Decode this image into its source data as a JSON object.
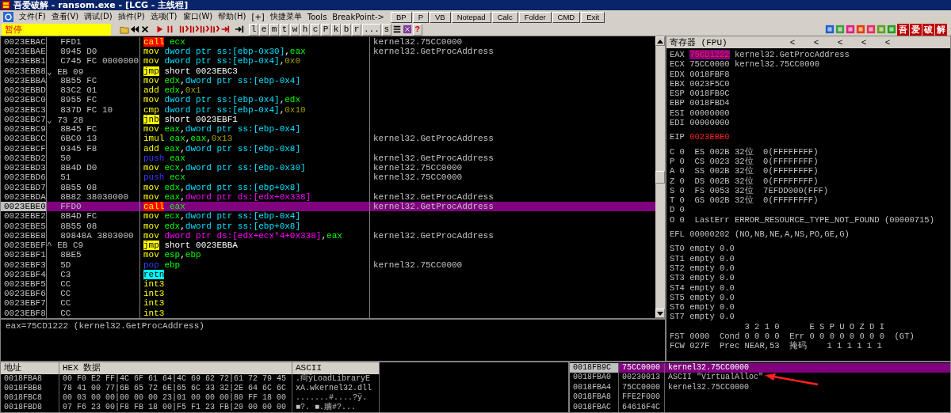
{
  "window": {
    "title": "吾爱破解 - ransom.exe - [LCG -  主线程]"
  },
  "menu": [
    "文件(F)",
    "查看(V)",
    "调试(D)",
    "插件(P)",
    "选项(T)",
    "窗口(W)",
    "帮助(H)",
    "[+]",
    "快捷菜单",
    "Tools",
    "BreakPoint->"
  ],
  "toolbar": {
    "status": "暂停",
    "letters": [
      "l",
      "e",
      "m",
      "t",
      "w",
      "h",
      "c",
      "P",
      "k",
      "b",
      "r",
      "...",
      "s"
    ],
    "help": "?",
    "tiles": [
      "吾",
      "爱",
      "破",
      "解"
    ]
  },
  "tool_buttons": [
    "BP",
    "P",
    "VB",
    "Notepad",
    "Calc",
    "Folder",
    "CMD",
    "Exit"
  ],
  "disassembly": [
    {
      "address": "0023EBAC",
      "hex": "FFD1",
      "mnemonic": "call",
      "kind": "call",
      "operands": [
        {
          "kind": "reg",
          "t": "ecx"
        }
      ],
      "comment": "kernel32.75CC0000",
      "selected": false
    },
    {
      "address": "0023EBAE",
      "hex": "8945 D0",
      "mnemonic": "mov",
      "kind": "op",
      "operands": [
        {
          "kind": "ss",
          "t": "dword ptr ss:[ebp-0x30]"
        },
        {
          "kind": "txt",
          "t": ","
        },
        {
          "kind": "reg",
          "t": "eax"
        }
      ],
      "comment": "kernel32.GetProcAddress",
      "selected": false
    },
    {
      "address": "0023EBB1",
      "hex": "C745 FC 0000000",
      "mnemonic": "mov",
      "kind": "op",
      "operands": [
        {
          "kind": "ss",
          "t": "dword ptr ss:[ebp-0x4]"
        },
        {
          "kind": "txt",
          "t": ","
        },
        {
          "kind": "imm",
          "t": "0x0"
        }
      ],
      "selected": false
    },
    {
      "address": "0023EBB8",
      "mark": "⌄",
      "hex": "EB 09",
      "mnemonic": "jmp",
      "kind": "jump",
      "operands": [
        {
          "kind": "txt",
          "t": "short 0023EBC3"
        }
      ],
      "selected": false
    },
    {
      "address": "0023EBBA",
      "hex": "8B55 FC",
      "mnemonic": "mov",
      "kind": "op",
      "operands": [
        {
          "kind": "reg",
          "t": "edx"
        },
        {
          "kind": "txt",
          "t": ","
        },
        {
          "kind": "ss",
          "t": "dword ptr ss:[ebp-0x4]"
        }
      ],
      "selected": false
    },
    {
      "address": "0023EBBD",
      "hex": "83C2 01",
      "mnemonic": "add",
      "kind": "op",
      "operands": [
        {
          "kind": "reg",
          "t": "edx"
        },
        {
          "kind": "txt",
          "t": ","
        },
        {
          "kind": "imm",
          "t": "0x1"
        }
      ],
      "selected": false
    },
    {
      "address": "0023EBC0",
      "hex": "8955 FC",
      "mnemonic": "mov",
      "kind": "op",
      "operands": [
        {
          "kind": "ss",
          "t": "dword ptr ss:[ebp-0x4]"
        },
        {
          "kind": "txt",
          "t": ","
        },
        {
          "kind": "reg",
          "t": "edx"
        }
      ],
      "selected": false
    },
    {
      "address": "0023EBC3",
      "hex": "837D FC 10",
      "mnemonic": "cmp",
      "kind": "op",
      "operands": [
        {
          "kind": "ss",
          "t": "dword ptr ss:[ebp-0x4]"
        },
        {
          "kind": "txt",
          "t": ","
        },
        {
          "kind": "imm",
          "t": "0x10"
        }
      ],
      "selected": false
    },
    {
      "address": "0023EBC7",
      "mark": "⌄",
      "hex": "73 28",
      "mnemonic": "jnb",
      "kind": "jump",
      "operands": [
        {
          "kind": "txt",
          "t": "short 0023EBF1"
        }
      ],
      "selected": false
    },
    {
      "address": "0023EBC9",
      "hex": "8B45 FC",
      "mnemonic": "mov",
      "kind": "op",
      "operands": [
        {
          "kind": "reg",
          "t": "eax"
        },
        {
          "kind": "txt",
          "t": ","
        },
        {
          "kind": "ss",
          "t": "dword ptr ss:[ebp-0x4]"
        }
      ],
      "selected": false
    },
    {
      "address": "0023EBCC",
      "hex": "6BC0 13",
      "mnemonic": "imul",
      "kind": "op",
      "operands": [
        {
          "kind": "reg",
          "t": "eax"
        },
        {
          "kind": "txt",
          "t": ","
        },
        {
          "kind": "reg",
          "t": "eax"
        },
        {
          "kind": "txt",
          "t": ","
        },
        {
          "kind": "imm",
          "t": "0x13"
        }
      ],
      "comment": "kernel32.GetProcAddress",
      "selected": false
    },
    {
      "address": "0023EBCF",
      "hex": "0345 F8",
      "mnemonic": "add",
      "kind": "op",
      "operands": [
        {
          "kind": "reg",
          "t": "eax"
        },
        {
          "kind": "txt",
          "t": ","
        },
        {
          "kind": "ss",
          "t": "dword ptr ss:[ebp-0x8]"
        }
      ],
      "selected": false
    },
    {
      "address": "0023EBD2",
      "hex": "50",
      "mnemonic": "push",
      "kind": "stack",
      "operands": [
        {
          "kind": "reg",
          "t": "eax"
        }
      ],
      "comment": "kernel32.GetProcAddress",
      "selected": false
    },
    {
      "address": "0023EBD3",
      "hex": "8B4D D0",
      "mnemonic": "mov",
      "kind": "op",
      "operands": [
        {
          "kind": "reg",
          "t": "ecx"
        },
        {
          "kind": "txt",
          "t": ","
        },
        {
          "kind": "ss",
          "t": "dword ptr ss:[ebp-0x30]"
        }
      ],
      "comment": "kernel32.75CC0000",
      "selected": false
    },
    {
      "address": "0023EBD6",
      "hex": "51",
      "mnemonic": "push",
      "kind": "stack",
      "operands": [
        {
          "kind": "reg",
          "t": "ecx"
        }
      ],
      "comment": "kernel32.75CC0000",
      "selected": false
    },
    {
      "address": "0023EBD7",
      "hex": "8B55 08",
      "mnemonic": "mov",
      "kind": "op",
      "operands": [
        {
          "kind": "reg",
          "t": "edx"
        },
        {
          "kind": "txt",
          "t": ","
        },
        {
          "kind": "ss",
          "t": "dword ptr ss:[ebp+0x8]"
        }
      ],
      "selected": false
    },
    {
      "address": "0023EBDA",
      "hex": "8B82 38030000",
      "mnemonic": "mov",
      "kind": "op",
      "operands": [
        {
          "kind": "reg",
          "t": "eax"
        },
        {
          "kind": "txt",
          "t": ","
        },
        {
          "kind": "ds",
          "t": "dword ptr ds:[edx+0x338]"
        }
      ],
      "comment": "kernel32.GetProcAddress",
      "selected": false
    },
    {
      "address": "0023EBE0",
      "hex": "FFD0",
      "mnemonic": "call",
      "kind": "call",
      "operands": [
        {
          "kind": "reg",
          "t": "eax"
        }
      ],
      "comment": "kernel32.GetProcAddress",
      "selected": true
    },
    {
      "address": "0023EBE2",
      "hex": "8B4D FC",
      "mnemonic": "mov",
      "kind": "op",
      "operands": [
        {
          "kind": "reg",
          "t": "ecx"
        },
        {
          "kind": "txt",
          "t": ","
        },
        {
          "kind": "ss",
          "t": "dword ptr ss:[ebp-0x4]"
        }
      ],
      "selected": false
    },
    {
      "address": "0023EBE5",
      "hex": "8B55 08",
      "mnemonic": "mov",
      "kind": "op",
      "operands": [
        {
          "kind": "reg",
          "t": "edx"
        },
        {
          "kind": "txt",
          "t": ","
        },
        {
          "kind": "ss",
          "t": "dword ptr ss:[ebp+0x8]"
        }
      ],
      "selected": false
    },
    {
      "address": "0023EBE8",
      "hex": "89848A 3803000",
      "mnemonic": "mov",
      "kind": "op",
      "operands": [
        {
          "kind": "ds",
          "t": "dword ptr ds:[edx+ecx*4+0x338]"
        },
        {
          "kind": "txt",
          "t": ","
        },
        {
          "kind": "reg",
          "t": "eax"
        }
      ],
      "comment": "kernel32.GetProcAddress",
      "selected": false
    },
    {
      "address": "0023EBEF",
      "mark": "^",
      "hex": "EB C9",
      "mnemonic": "jmp",
      "kind": "jump",
      "operands": [
        {
          "kind": "txt",
          "t": "short 0023EBBA"
        }
      ],
      "selected": false
    },
    {
      "address": "0023EBF1",
      "hex": "8BE5",
      "mnemonic": "mov",
      "kind": "op",
      "operands": [
        {
          "kind": "reg",
          "t": "esp"
        },
        {
          "kind": "txt",
          "t": ","
        },
        {
          "kind": "reg",
          "t": "ebp"
        }
      ],
      "selected": false
    },
    {
      "address": "0023EBF3",
      "hex": "5D",
      "mnemonic": "pop",
      "kind": "stack",
      "operands": [
        {
          "kind": "reg",
          "t": "ebp"
        }
      ],
      "comment": "kernel32.75CC0000",
      "selected": false
    },
    {
      "address": "0023EBF4",
      "hex": "C3",
      "mnemonic": "retn",
      "kind": "ret",
      "selected": false
    },
    {
      "address": "0023EBF5",
      "hex": "CC",
      "mnemonic": "int3",
      "kind": "op",
      "selected": false
    },
    {
      "address": "0023EBF6",
      "hex": "CC",
      "mnemonic": "int3",
      "kind": "op",
      "selected": false
    },
    {
      "address": "0023EBF7",
      "hex": "CC",
      "mnemonic": "int3",
      "kind": "op",
      "selected": false
    },
    {
      "address": "0023EBF8",
      "hex": "CC",
      "mnemonic": "int3",
      "kind": "op",
      "selected": false
    }
  ],
  "info_line": "eax=75CD1222 (kernel32.GetProcAddress)",
  "registers_panel": {
    "title": "寄存器 (FPU)",
    "arrows": [
      "<",
      "<",
      "<",
      "<",
      "<"
    ],
    "registers": [
      {
        "name": "EAX",
        "value": "75CD1222",
        "comment": "kernel32.GetProcAddress",
        "changed": true,
        "selected": true
      },
      {
        "name": "ECX",
        "value": "75CC0000",
        "comment": "kernel32.75CC0000",
        "changed": false,
        "selected": false
      },
      {
        "name": "EDX",
        "value": "0018FBF8",
        "changed": false,
        "selected": false
      },
      {
        "name": "EBX",
        "value": "0023F5C0",
        "changed": false,
        "selected": false
      },
      {
        "name": "ESP",
        "value": "0018FB9C",
        "changed": false,
        "selected": false
      },
      {
        "name": "EBP",
        "value": "0018FBD4",
        "changed": false,
        "selected": false
      },
      {
        "name": "ESI",
        "value": "00000000",
        "changed": false,
        "selected": false
      },
      {
        "name": "EDI",
        "value": "00000000",
        "changed": false,
        "selected": false
      }
    ],
    "eip": {
      "name": "EIP",
      "value": "0023EBE0",
      "changed": true,
      "selected": false
    },
    "flag_lines": [
      "C 0  ES 002B 32位  0(FFFFFFFF)",
      "P 0  CS 0023 32位  0(FFFFFFFF)",
      "A 0  SS 002B 32位  0(FFFFFFFF)",
      "Z 0  DS 002B 32位  0(FFFFFFFF)",
      "S 0  FS 0053 32位  7EFDD000(FFF)",
      "T 0  GS 002B 32位  0(FFFFFFFF)",
      "D 0",
      "O 0  LastErr ERROR_RESOURCE_TYPE_NOT_FOUND (00000715)"
    ],
    "efl_line": "EFL 00000202 (NO,NB,NE,A,NS,PO,GE,G)",
    "fpu_stack": [
      "ST0 empty 0.0",
      "ST1 empty 0.0",
      "ST2 empty 0.0",
      "ST3 empty 0.0",
      "ST4 empty 0.0",
      "ST5 empty 0.0",
      "ST6 empty 0.0",
      "ST7 empty 0.0"
    ],
    "fpu_lines": [
      "               3 2 1 0      E S P U O Z D I",
      "FST 0000  Cond 0 0 0 0  Err 0 0 0 0 0 0 0 0  (GT)",
      "FCW 027F  Prec NEAR,53  掩码    1 1 1 1 1 1"
    ]
  },
  "dump": {
    "columns": [
      "地址",
      "HEX 数据",
      "ASCII"
    ],
    "rows": [
      {
        "address": "0018FBA8",
        "hex": "00 F0 E2 FF|4C 6F 61 64|4C 69 62 72|61 72 79 45",
        "ascii": ".疴ÿLoadLibraryE"
      },
      {
        "address": "0018FBB8",
        "hex": "78 41 00 77|6B 65 72 6E|65 6C 33 32|2E 64 6C 6C",
        "ascii": "xA.wkernel32.dll"
      },
      {
        "address": "0018FBC8",
        "hex": "00 03 00 00|00 00 00 23|01 00 00 00|80 FF 18 00",
        "ascii": ".......#....?ÿ."
      },
      {
        "address": "0018FBD8",
        "hex": "07 F6 23 00|F8 FB 18 00|F5 F1 23 FB|20 00 00 00",
        "ascii": "■?. ■.牆#?..."
      }
    ]
  },
  "stack": [
    {
      "address": "0018FB9C",
      "value": "75CC0000",
      "comment": "kernel32.75CC0000",
      "selected": true,
      "annotated": false
    },
    {
      "address": "0018FBA0",
      "value": "00230013",
      "comment": "ASCII \"VirtualAlloc\"",
      "selected": false,
      "annotated": true
    },
    {
      "address": "0018FBA4",
      "value": "75CC0000",
      "comment": "kernel32.75CC0000",
      "selected": false,
      "annotated": false
    },
    {
      "address": "0018FBA8",
      "value": "FFE2F000",
      "selected": false,
      "annotated": false
    },
    {
      "address": "0018FBAC",
      "value": "64616F4C",
      "selected": false,
      "annotated": false
    }
  ]
}
